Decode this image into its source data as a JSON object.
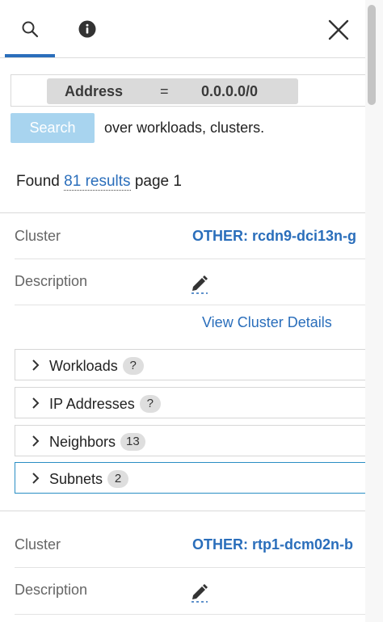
{
  "tabs": [
    {
      "icon": "search-icon",
      "active": true
    },
    {
      "icon": "info-icon",
      "active": false
    }
  ],
  "query": {
    "field": "Address",
    "operator": "=",
    "value": "0.0.0.0/0"
  },
  "search": {
    "button_label": "Search",
    "hint": "over workloads, clusters."
  },
  "results": {
    "prefix": "Found",
    "count_link": "81 results",
    "suffix": "page 1"
  },
  "cards": [
    {
      "cluster_label": "Cluster",
      "cluster_value": "OTHER: rcdn9-dci13n-g",
      "description_label": "Description",
      "view_details": "View Cluster Details",
      "sections": [
        {
          "label": "Workloads",
          "badge": "?"
        },
        {
          "label": "IP Addresses",
          "badge": "?"
        },
        {
          "label": "Neighbors",
          "badge": "13"
        },
        {
          "label": "Subnets",
          "badge": "2"
        }
      ]
    },
    {
      "cluster_label": "Cluster",
      "cluster_value": "OTHER: rtp1-dcm02n-b",
      "description_label": "Description"
    }
  ],
  "colors": {
    "accent": "#2a6ebb",
    "search_button": "#a8d4ef",
    "active_border": "#2a8ec4",
    "chip_bg": "#dadada"
  }
}
